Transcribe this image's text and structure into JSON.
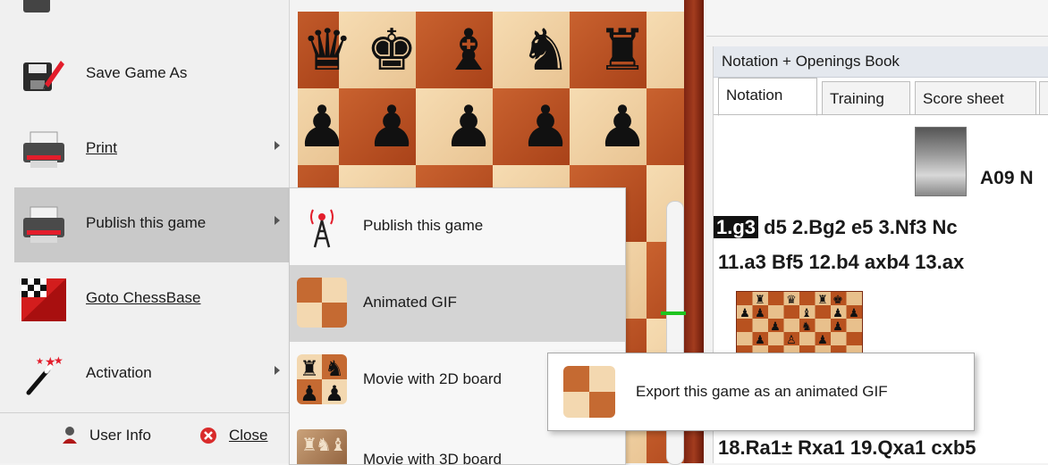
{
  "menu": {
    "items": [
      {
        "label": "Save Game As",
        "has_submenu": false,
        "icon": "save-as-icon"
      },
      {
        "label": "Print",
        "has_submenu": true,
        "icon": "printer-icon"
      },
      {
        "label": "Publish this game",
        "has_submenu": true,
        "icon": "printer-icon",
        "active": true
      },
      {
        "label": "Goto ChessBase",
        "has_submenu": false,
        "icon": "chessbase-logo-icon"
      },
      {
        "label": "Activation",
        "has_submenu": true,
        "icon": "magic-wand-icon"
      }
    ],
    "footer": {
      "user_info": "User Info",
      "close": "Close"
    }
  },
  "submenu": {
    "items": [
      {
        "label": "Publish this game",
        "icon": "broadcast-tower-icon"
      },
      {
        "label": "Animated GIF",
        "icon": "animated-gif-icon",
        "active": true
      },
      {
        "label": "Movie with 2D board",
        "icon": "2d-board-icon"
      },
      {
        "label": "Movie with 3D board",
        "icon": "3d-board-icon"
      }
    ]
  },
  "tooltip": {
    "text": "Export this game as an animated GIF"
  },
  "notation_pane": {
    "title": "Notation + Openings Book",
    "tabs": [
      "Notation",
      "Training",
      "Score sheet"
    ],
    "active_tab": "Notation",
    "opening_code": "A09 N",
    "moves": {
      "current_move": "1.g3",
      "line1_rest": " d5  2.Bg2  e5  3.Nf3  Nc",
      "line2": "11.a3  Bf5  12.b4  axb4  13.ax",
      "line3": "18.Ra1±  Rxa1  19.Qxa1  cxb5"
    }
  },
  "board": {
    "top_row": [
      "♛",
      "♚",
      "♝",
      "♞",
      "♜"
    ],
    "pawn_row": [
      "♟",
      "♟",
      "♟",
      "♟",
      "♟"
    ]
  },
  "colors": {
    "board_light": "#f6dcb2",
    "board_dark": "#c9622f",
    "menu_active": "#c9c9c9",
    "slider_marker": "#1ec41e"
  }
}
